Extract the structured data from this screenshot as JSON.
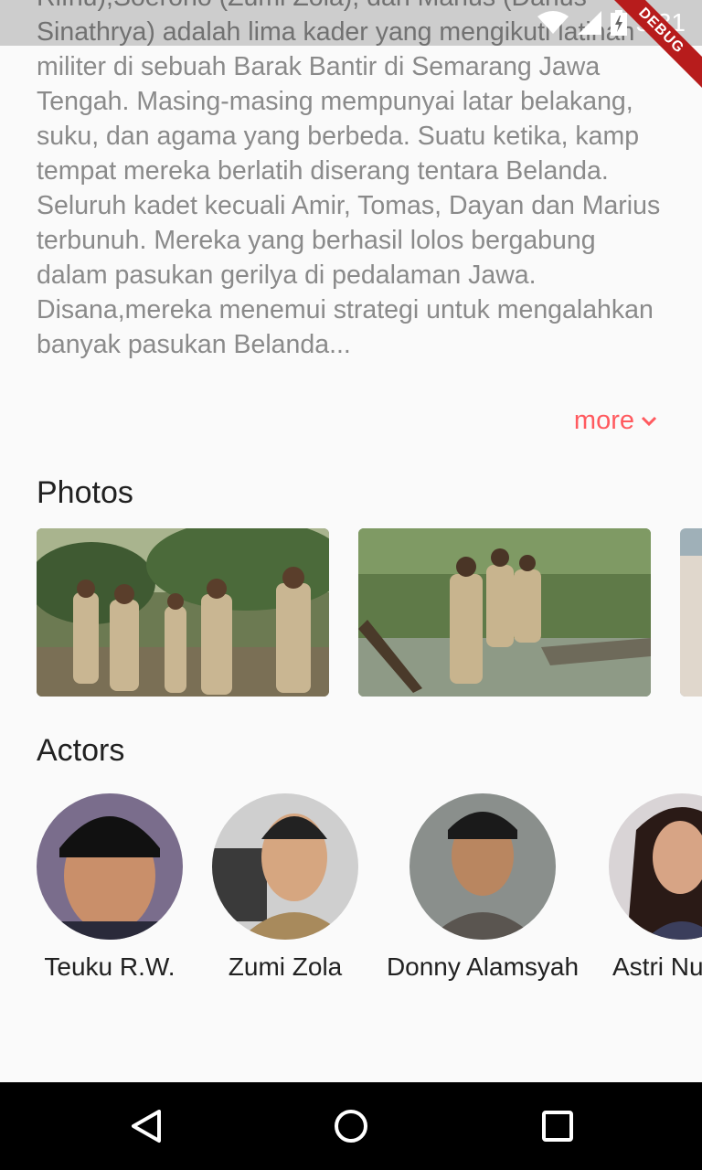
{
  "status_bar": {
    "time": "5:31",
    "debug_label": "DEBUG"
  },
  "synopsis": {
    "text": "Rifnu),Soerono (Zumi Zola), dan Marius (Darius Sinathrya) adalah lima kader yang mengikuti latihan militer di sebuah Barak Bantir di Semarang  Jawa Tengah. Masing-masing mempunyai latar belakang, suku, dan agama yang berbeda. Suatu ketika, kamp tempat mereka berlatih diserang tentara Belanda. Seluruh kadet kecuali Amir, Tomas, Dayan dan Marius terbunuh. Mereka yang berhasil lolos bergabung dalam pasukan gerilya di pedalaman Jawa. Disana,mereka menemui strategi untuk mengalahkan banyak pasukan Belanda...",
    "more_label": "more"
  },
  "photos": {
    "title": "Photos"
  },
  "actors": {
    "title": "Actors",
    "items": [
      {
        "name": "Teuku R.W."
      },
      {
        "name": "Zumi Zola"
      },
      {
        "name": "Donny Alamsyah"
      },
      {
        "name": "Astri Nu"
      }
    ]
  },
  "colors": {
    "accent": "#ff5a5f",
    "background": "#fafafa",
    "nav": "#000000"
  }
}
